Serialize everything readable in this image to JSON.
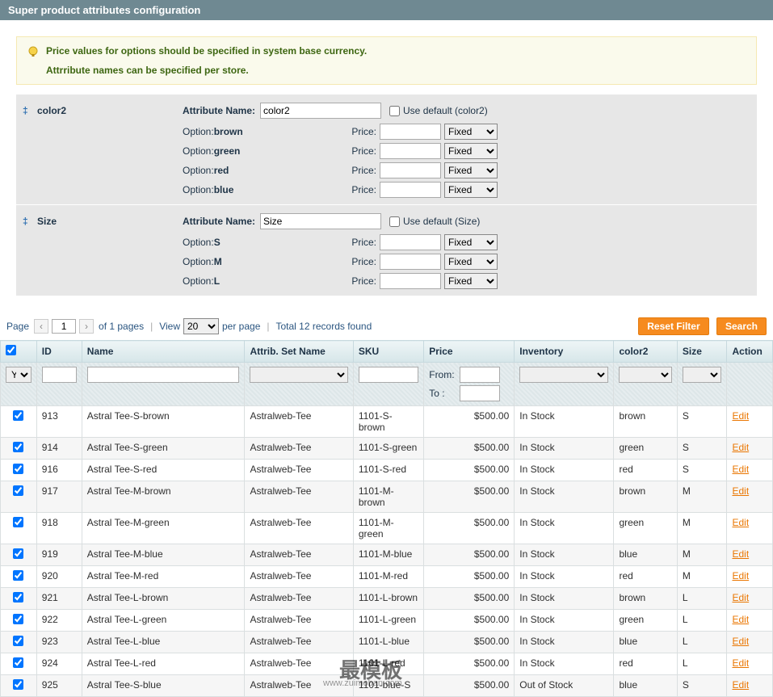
{
  "panel": {
    "title": "Super product attributes configuration"
  },
  "notice": {
    "line1": "Price values for options should be specified in system base currency.",
    "line2": "Attrribute names can be specified per store."
  },
  "attributes": [
    {
      "key": "color2",
      "title": "color2",
      "nameLabel": "Attribute Name:",
      "nameValue": "color2",
      "useDefaultLabel": "Use default (color2)",
      "options": [
        {
          "label": "Option:",
          "value": "brown",
          "priceLabel": "Price:",
          "priceValue": "",
          "priceType": "Fixed"
        },
        {
          "label": "Option:",
          "value": "green",
          "priceLabel": "Price:",
          "priceValue": "",
          "priceType": "Fixed"
        },
        {
          "label": "Option:",
          "value": "red",
          "priceLabel": "Price:",
          "priceValue": "",
          "priceType": "Fixed"
        },
        {
          "label": "Option:",
          "value": "blue",
          "priceLabel": "Price:",
          "priceValue": "",
          "priceType": "Fixed"
        }
      ]
    },
    {
      "key": "size",
      "title": "Size",
      "nameLabel": "Attribute Name:",
      "nameValue": "Size",
      "useDefaultLabel": "Use default (Size)",
      "options": [
        {
          "label": "Option:",
          "value": "S",
          "priceLabel": "Price:",
          "priceValue": "",
          "priceType": "Fixed"
        },
        {
          "label": "Option:",
          "value": "M",
          "priceLabel": "Price:",
          "priceValue": "",
          "priceType": "Fixed"
        },
        {
          "label": "Option:",
          "value": "L",
          "priceLabel": "Price:",
          "priceValue": "",
          "priceType": "Fixed"
        }
      ]
    }
  ],
  "pager": {
    "pageLabel": "Page",
    "pageValue": "1",
    "ofPages": "of 1 pages",
    "viewLabel": "View",
    "perPageValue": "20",
    "perPageLabel": "per page",
    "totalLabel": "Total 12 records found",
    "resetLabel": "Reset Filter",
    "searchLabel": "Search"
  },
  "columns": {
    "id": "ID",
    "name": "Name",
    "attrset": "Attrib. Set Name",
    "sku": "SKU",
    "price": "Price",
    "inventory": "Inventory",
    "color2": "color2",
    "size": "Size",
    "action": "Action"
  },
  "filters": {
    "selectYes": "Yes",
    "fromLabel": "From:",
    "toLabel": "To :"
  },
  "rows": [
    {
      "id": "913",
      "name": "Astral Tee-S-brown",
      "attrset": "Astralweb-Tee",
      "sku": "1101-S-brown",
      "price": "$500.00",
      "inventory": "In Stock",
      "color2": "brown",
      "size": "S",
      "action": "Edit"
    },
    {
      "id": "914",
      "name": "Astral Tee-S-green",
      "attrset": "Astralweb-Tee",
      "sku": "1101-S-green",
      "price": "$500.00",
      "inventory": "In Stock",
      "color2": "green",
      "size": "S",
      "action": "Edit"
    },
    {
      "id": "916",
      "name": "Astral Tee-S-red",
      "attrset": "Astralweb-Tee",
      "sku": "1101-S-red",
      "price": "$500.00",
      "inventory": "In Stock",
      "color2": "red",
      "size": "S",
      "action": "Edit"
    },
    {
      "id": "917",
      "name": "Astral Tee-M-brown",
      "attrset": "Astralweb-Tee",
      "sku": "1101-M-brown",
      "price": "$500.00",
      "inventory": "In Stock",
      "color2": "brown",
      "size": "M",
      "action": "Edit"
    },
    {
      "id": "918",
      "name": "Astral Tee-M-green",
      "attrset": "Astralweb-Tee",
      "sku": "1101-M-green",
      "price": "$500.00",
      "inventory": "In Stock",
      "color2": "green",
      "size": "M",
      "action": "Edit"
    },
    {
      "id": "919",
      "name": "Astral Tee-M-blue",
      "attrset": "Astralweb-Tee",
      "sku": "1101-M-blue",
      "price": "$500.00",
      "inventory": "In Stock",
      "color2": "blue",
      "size": "M",
      "action": "Edit"
    },
    {
      "id": "920",
      "name": "Astral Tee-M-red",
      "attrset": "Astralweb-Tee",
      "sku": "1101-M-red",
      "price": "$500.00",
      "inventory": "In Stock",
      "color2": "red",
      "size": "M",
      "action": "Edit"
    },
    {
      "id": "921",
      "name": "Astral Tee-L-brown",
      "attrset": "Astralweb-Tee",
      "sku": "1101-L-brown",
      "price": "$500.00",
      "inventory": "In Stock",
      "color2": "brown",
      "size": "L",
      "action": "Edit"
    },
    {
      "id": "922",
      "name": "Astral Tee-L-green",
      "attrset": "Astralweb-Tee",
      "sku": "1101-L-green",
      "price": "$500.00",
      "inventory": "In Stock",
      "color2": "green",
      "size": "L",
      "action": "Edit"
    },
    {
      "id": "923",
      "name": "Astral Tee-L-blue",
      "attrset": "Astralweb-Tee",
      "sku": "1101-L-blue",
      "price": "$500.00",
      "inventory": "In Stock",
      "color2": "blue",
      "size": "L",
      "action": "Edit"
    },
    {
      "id": "924",
      "name": "Astral Tee-L-red",
      "attrset": "Astralweb-Tee",
      "sku": "1101-L-red",
      "price": "$500.00",
      "inventory": "In Stock",
      "color2": "red",
      "size": "L",
      "action": "Edit"
    },
    {
      "id": "925",
      "name": "Astral Tee-S-blue",
      "attrset": "Astralweb-Tee",
      "sku": "1101-blue-S",
      "price": "$500.00",
      "inventory": "Out of Stock",
      "color2": "blue",
      "size": "S",
      "action": "Edit"
    }
  ],
  "watermark": {
    "main": "最模板",
    "sub": "www.zuimoban.com"
  }
}
